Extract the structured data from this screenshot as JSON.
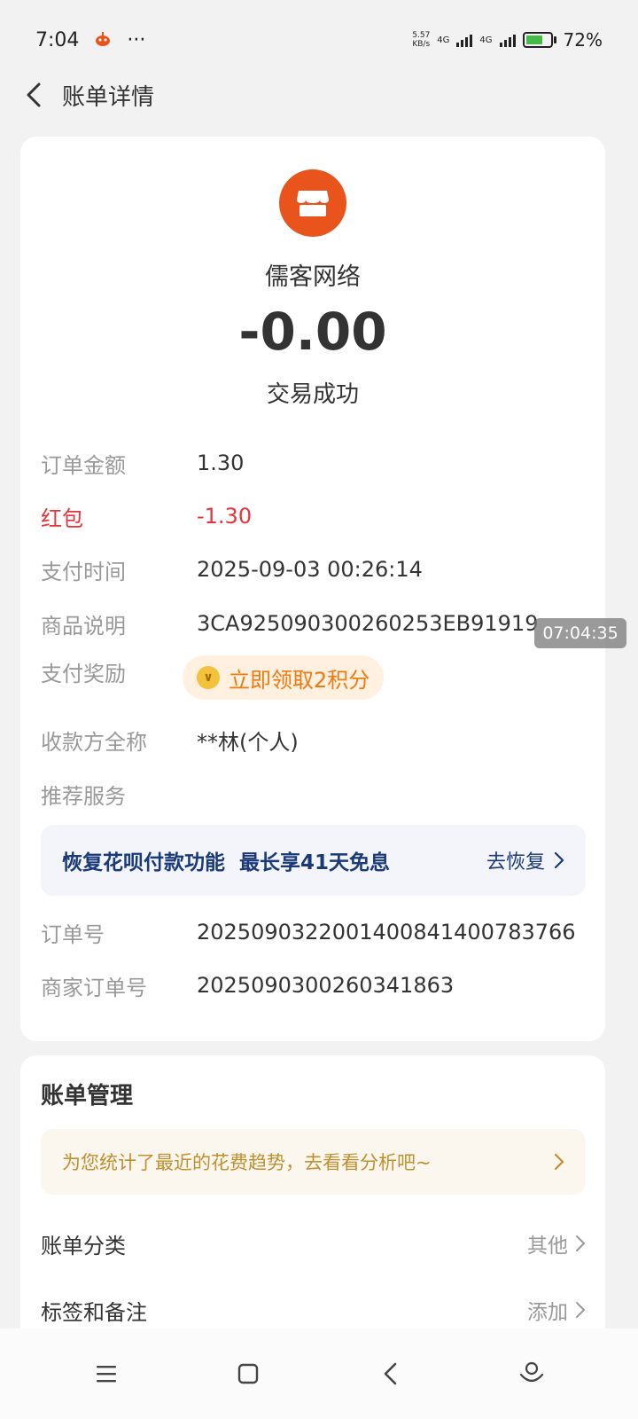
{
  "status_bar": {
    "time": "7:04",
    "dots": "···",
    "net_speed_top": "5.57",
    "net_speed_bottom": "KB/s",
    "sim1": "4G",
    "sim2": "4G",
    "battery": "72%"
  },
  "header": {
    "title": "账单详情"
  },
  "transaction": {
    "merchant": "儒客网络",
    "amount": "-0.00",
    "status": "交易成功"
  },
  "details": {
    "order_amount_label": "订单金额",
    "order_amount": "1.30",
    "red_packet_label": "红包",
    "red_packet": "-1.30",
    "pay_time_label": "支付时间",
    "pay_time": "2025-09-03 00:26:14",
    "product_label": "商品说明",
    "product": "3CA925090300260253EB91919",
    "reward_label": "支付奖励",
    "reward": "立即领取2积分",
    "payee_label": "收款方全称",
    "payee": "**林(个人)",
    "recommend_label": "推荐服务",
    "order_no_label": "订单号",
    "order_no": "2025090322001400841400783766",
    "merchant_order_label": "商家订单号",
    "merchant_order": "2025090300260341863"
  },
  "promo": {
    "text": "恢复花呗付款功能  最长享41天免息",
    "action": "去恢复"
  },
  "floating_time": "07:04:35",
  "manage": {
    "title": "账单管理",
    "trend_text": "为您统计了最近的花费趋势，去看看分析吧~",
    "category_label": "账单分类",
    "category_value": "其他",
    "tags_label": "标签和备注",
    "tags_value": "添加"
  },
  "colors": {
    "brand_orange": "#e8541c",
    "red": "#e8333a",
    "promo_blue": "#1a3a7a"
  }
}
